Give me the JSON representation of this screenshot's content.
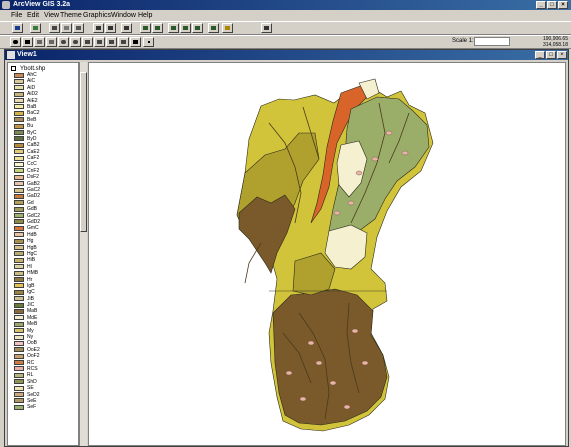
{
  "window": {
    "title": "ArcView GIS 3.2a"
  },
  "menu": [
    "File",
    "Edit",
    "View",
    "Theme",
    "Graphics",
    "Window",
    "Help"
  ],
  "scale": {
    "label": "Scale 1:",
    "value": ""
  },
  "coords": {
    "x": "190,906.65",
    "y": "314,058.18"
  },
  "view": {
    "title": "View1"
  },
  "theme": {
    "name": "Ybott.shp"
  },
  "legend": [
    {
      "label": "AhC",
      "color": "#c98a5a"
    },
    {
      "label": "AiC",
      "color": "#d9c89a"
    },
    {
      "label": "AiD",
      "color": "#e6e1a8"
    },
    {
      "label": "AiD2",
      "color": "#c8b27e"
    },
    {
      "label": "AiE2",
      "color": "#e8d9b0"
    },
    {
      "label": "BaB",
      "color": "#f2eaa0"
    },
    {
      "label": "BaC2",
      "color": "#d4b24a"
    },
    {
      "label": "BeB",
      "color": "#a38a5c"
    },
    {
      "label": "Bu",
      "color": "#c0944a"
    },
    {
      "label": "ByC",
      "color": "#7b8a52"
    },
    {
      "label": "ByD",
      "color": "#5e6e3a"
    },
    {
      "label": "CaB2",
      "color": "#b58a3c"
    },
    {
      "label": "CaE2",
      "color": "#e0cc78"
    },
    {
      "label": "CaF2",
      "color": "#ece29a"
    },
    {
      "label": "CcC",
      "color": "#fbf6cf"
    },
    {
      "label": "CnF2",
      "color": "#c8d27a"
    },
    {
      "label": "DsF2",
      "color": "#e8b890"
    },
    {
      "label": "GaB2",
      "color": "#e6c4b2"
    },
    {
      "label": "GaC2",
      "color": "#d4c08a"
    },
    {
      "label": "GaD2",
      "color": "#c87a3a"
    },
    {
      "label": "Gd",
      "color": "#b0a058"
    },
    {
      "label": "GdB",
      "color": "#9e9c5c"
    },
    {
      "label": "GdC2",
      "color": "#a0b06e"
    },
    {
      "label": "GdD2",
      "color": "#8e8a46"
    },
    {
      "label": "GmC",
      "color": "#d8743a"
    },
    {
      "label": "HdB",
      "color": "#eac2a0"
    },
    {
      "label": "Hg",
      "color": "#a4924e"
    },
    {
      "label": "HgB",
      "color": "#d6c08c"
    },
    {
      "label": "HgC",
      "color": "#b4ac70"
    },
    {
      "label": "HiB",
      "color": "#c6b266"
    },
    {
      "label": "Hl",
      "color": "#dad2a0"
    },
    {
      "label": "HMB",
      "color": "#cbbc84"
    },
    {
      "label": "Hr",
      "color": "#8a7a42"
    },
    {
      "label": "IgB",
      "color": "#e4c250"
    },
    {
      "label": "IgC",
      "color": "#9c8240"
    },
    {
      "label": "JiB",
      "color": "#cfc092"
    },
    {
      "label": "JiC",
      "color": "#6c7a3c"
    },
    {
      "label": "MaB",
      "color": "#8a6a3a"
    },
    {
      "label": "MdE",
      "color": "#f2ecd0"
    },
    {
      "label": "MeB",
      "color": "#9aa86a"
    },
    {
      "label": "My",
      "color": "#d6c26a"
    },
    {
      "label": "Ny",
      "color": "#eae6c2"
    },
    {
      "label": "OoB",
      "color": "#f2c2c2"
    },
    {
      "label": "OoE2",
      "color": "#a08c54"
    },
    {
      "label": "OoF2",
      "color": "#c8a070"
    },
    {
      "label": "RC",
      "color": "#ce7a44"
    },
    {
      "label": "RCS",
      "color": "#eab0a8"
    },
    {
      "label": "RL",
      "color": "#b8b480"
    },
    {
      "label": "ShD",
      "color": "#8c9456"
    },
    {
      "label": "SE",
      "color": "#f0e4b0"
    },
    {
      "label": "SeD2",
      "color": "#d0a880"
    },
    {
      "label": "SeE",
      "color": "#b09868"
    },
    {
      "label": "SeF",
      "color": "#9ab070"
    }
  ],
  "map_colors": {
    "yellow": "#d2c43a",
    "olive": "#b0a02e",
    "brown": "#7a5a2a",
    "orange": "#d9642a",
    "green": "#9aae6a",
    "cream": "#f4f0d0",
    "pink": "#e8b4a8"
  }
}
